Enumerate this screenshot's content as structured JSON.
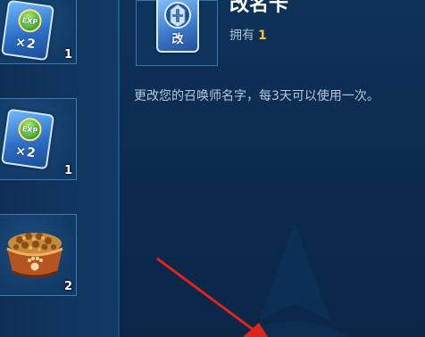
{
  "inventory": [
    {
      "icon": "exp-card-icon",
      "badge_text": "EXP",
      "multiplier": "×2",
      "count": "1"
    },
    {
      "icon": "exp-card-icon",
      "badge_text": "EXP",
      "multiplier": "×2",
      "count": "1"
    },
    {
      "icon": "pet-food-bowl-icon",
      "count": "2"
    }
  ],
  "detail": {
    "icon": "rename-card-icon",
    "icon_char": "改",
    "title": "改名卡",
    "owned_label": "拥有",
    "owned_count": "1",
    "description": "更改您的召唤师名字，每3天可以使用一次。"
  },
  "colors": {
    "background": "#0b2a4e",
    "accent_count": "#f6c13a",
    "annotation_arrow": "#e0241b"
  }
}
